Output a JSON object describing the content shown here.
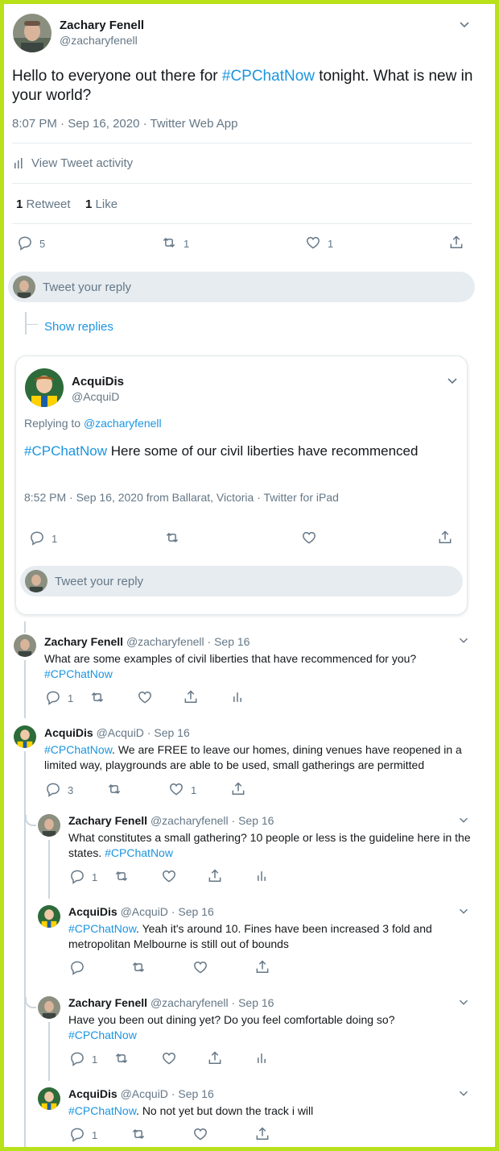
{
  "main_tweet": {
    "name": "Zachary Fenell",
    "handle": "@zacharyfenell",
    "text_before": "Hello to everyone out there for ",
    "hashtag": "#CPChatNow",
    "text_after": " tonight. What is new in your world?",
    "meta": "8:07 PM · Sep 16, 2020 · Twitter Web App",
    "activity_label": "View Tweet activity",
    "retweet_count": "1",
    "retweet_label": "Retweet",
    "like_count": "1",
    "like_label": "Like",
    "actions": {
      "reply": "5",
      "retweet": "1",
      "like": "1"
    }
  },
  "reply_prompt": "Tweet your reply",
  "show_replies": "Show replies",
  "quoted_reply": {
    "name": "AcquiDis",
    "handle": "@AcquiD",
    "replying_prefix": "Replying to ",
    "replying_to": "@zacharyfenell",
    "hashtag": "#CPChatNow",
    "text": " Here some of our civil liberties have recommenced",
    "meta": "8:52 PM · Sep 16, 2020 from Ballarat, Victoria · Twitter for iPad",
    "actions": {
      "reply": "1",
      "retweet": "",
      "like": ""
    },
    "reply_prompt": "Tweet your reply"
  },
  "thread": [
    {
      "name": "Zachary Fenell",
      "handle": "@zacharyfenell",
      "date": "· Sep 16",
      "text": "What are some examples of civil liberties that have recommenced for you?",
      "hashtag": "#CPChatNow",
      "text_after": "",
      "actions": {
        "reply": "1",
        "retweet": "",
        "like": ""
      }
    },
    {
      "name": "AcquiDis",
      "handle": "@AcquiD",
      "date": "· Sep 16",
      "hashtag": "#CPChatNow",
      "text": ". We are FREE to leave our homes, dining venues have reopened in a limited way, playgrounds are able to be used, small gatherings are permitted",
      "actions": {
        "reply": "3",
        "retweet": "",
        "like": "1"
      }
    },
    {
      "name": "Zachary Fenell",
      "handle": "@zacharyfenell",
      "date": "· Sep 16",
      "text": "What constitutes a small gathering? 10 people or less is the guideline here in the states. ",
      "hashtag": "#CPChatNow",
      "actions": {
        "reply": "1",
        "retweet": "",
        "like": ""
      }
    },
    {
      "name": "AcquiDis",
      "handle": "@AcquiD",
      "date": "· Sep 16",
      "hashtag": "#CPChatNow",
      "text": ". Yeah it's around 10.  Fines have been increased 3 fold and metropolitan Melbourne is still out of bounds",
      "actions": {
        "reply": "",
        "retweet": "",
        "like": ""
      }
    },
    {
      "name": "Zachary Fenell",
      "handle": "@zacharyfenell",
      "date": "· Sep 16",
      "text": "Have you been out dining yet? Do you feel comfortable doing so?",
      "hashtag": "#CPChatNow",
      "actions": {
        "reply": "1",
        "retweet": "",
        "like": ""
      }
    },
    {
      "name": "AcquiDis",
      "handle": "@AcquiD",
      "date": "· Sep 16",
      "hashtag": "#CPChatNow",
      "text": ". No not yet but down the track i will",
      "actions": {
        "reply": "1",
        "retweet": "",
        "like": ""
      }
    }
  ],
  "colors": {
    "border": "#b9e11a",
    "link": "#1b95e0",
    "muted": "#657786",
    "reply_box": "#e6ecf0"
  },
  "icons": [
    "chevron-down-icon",
    "reply-icon",
    "retweet-icon",
    "like-icon",
    "share-icon",
    "analytics-icon"
  ]
}
